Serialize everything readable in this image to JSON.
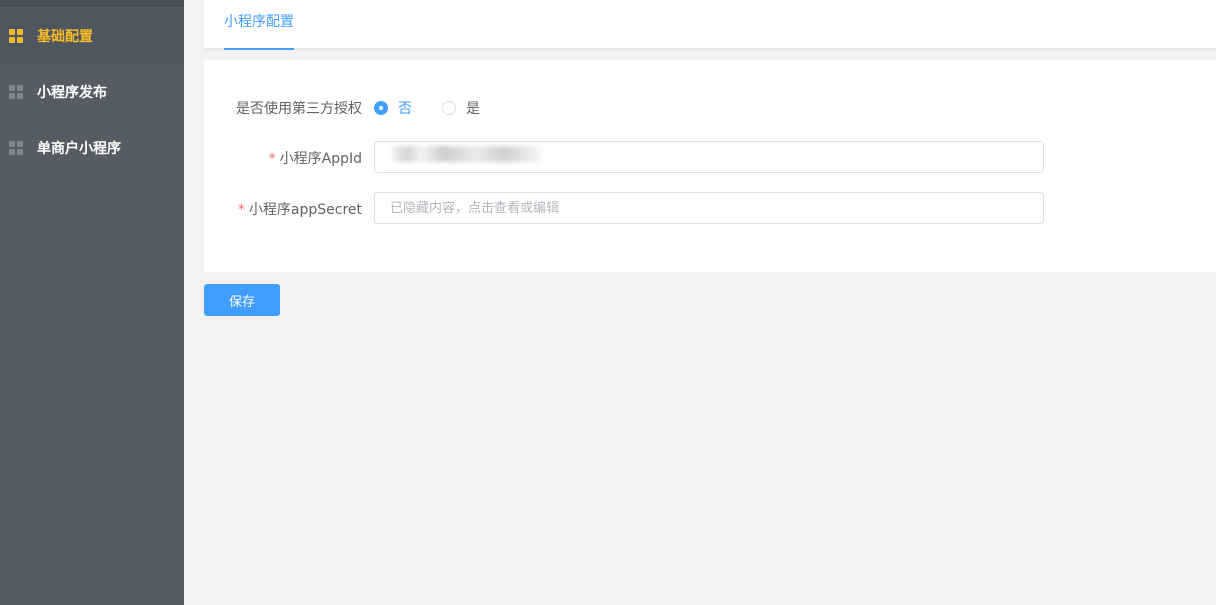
{
  "sidebar": {
    "items": [
      {
        "label": "基础配置",
        "icon": "grid-icon",
        "active": true
      },
      {
        "label": "小程序发布",
        "icon": "grid-icon",
        "active": false
      },
      {
        "label": "单商户小程序",
        "icon": "grid-icon",
        "active": false
      }
    ]
  },
  "tabs": [
    {
      "label": "小程序配置",
      "active": true
    }
  ],
  "form": {
    "third_party_auth": {
      "label": "是否使用第三方授权",
      "options": [
        {
          "label": "否",
          "checked": true
        },
        {
          "label": "是",
          "checked": false
        }
      ]
    },
    "appid": {
      "required_mark": "*",
      "label": "小程序AppId",
      "value": ""
    },
    "appsecret": {
      "required_mark": "*",
      "label": "小程序appSecret",
      "placeholder": "已隐藏内容，点击查看或编辑"
    }
  },
  "actions": {
    "save_label": "保存"
  },
  "colors": {
    "sidebar_bg": "#555c64",
    "active_accent": "#f6bb2a",
    "primary": "#409eff",
    "required": "#f56c6c"
  }
}
